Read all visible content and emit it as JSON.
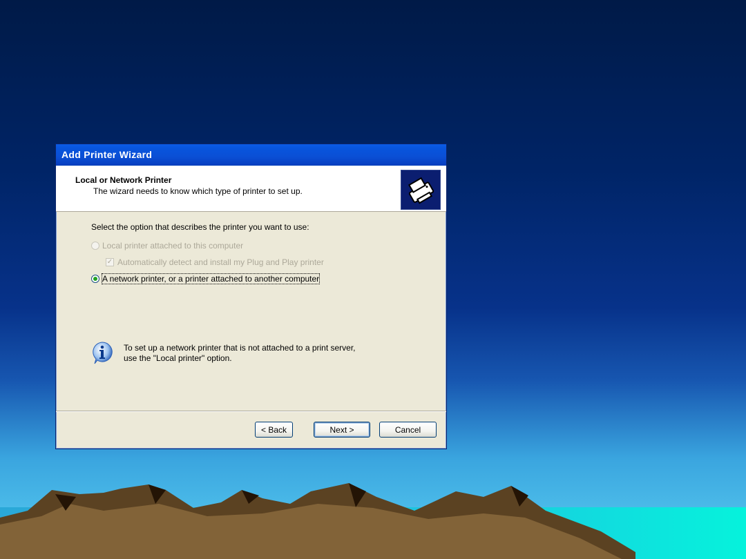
{
  "dialog": {
    "title": "Add Printer Wizard",
    "header_title": "Local or Network Printer",
    "header_subtitle": "The wizard needs to know which type of printer to set up.",
    "prompt": "Select the option that describes the printer you want to use:",
    "options": {
      "local": {
        "label": "Local printer attached to this computer",
        "selected": false,
        "enabled": false
      },
      "auto_detect": {
        "label": "Automatically detect and install my Plug and Play printer",
        "checked": true,
        "enabled": false
      },
      "network": {
        "label": "A network printer, or a printer attached to another computer",
        "selected": true,
        "enabled": true
      }
    },
    "info_line1": "To set up a network printer that is not attached to a print server,",
    "info_line2": "use the \"Local printer\" option.",
    "buttons": {
      "back": "< Back",
      "next": "Next >",
      "cancel": "Cancel"
    }
  },
  "icons": [
    "printer-icon",
    "info-icon"
  ],
  "colors": {
    "titlebar": "#0a5ce6",
    "dialog_bg": "#ece9d8",
    "radio_dot": "#21a121"
  }
}
